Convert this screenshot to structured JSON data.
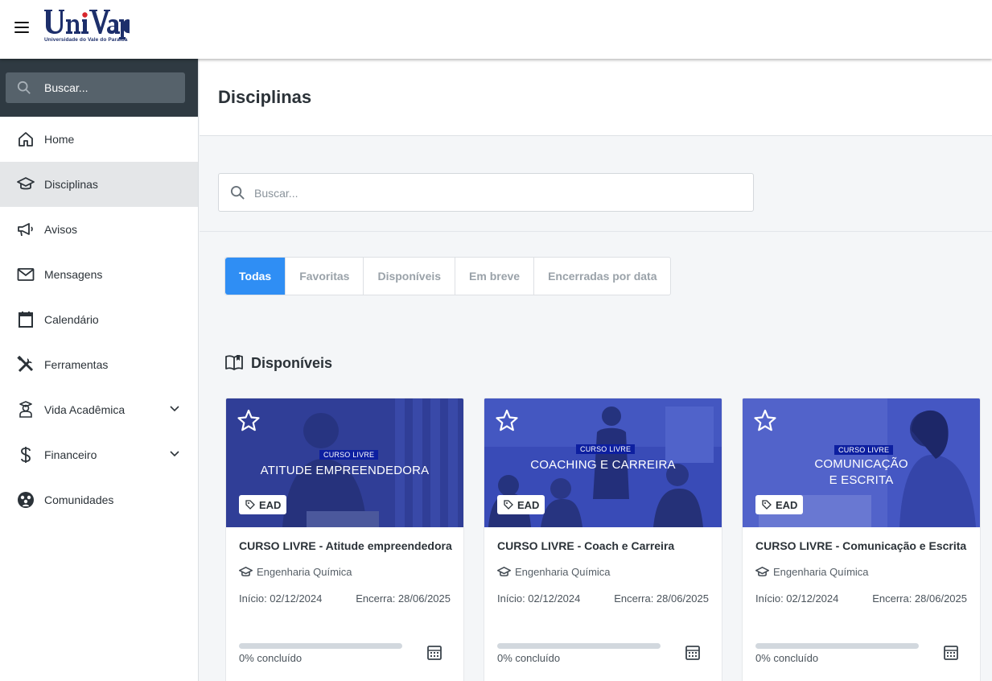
{
  "header": {
    "logo_text": "UniVap",
    "logo_subtitle": "Universidade do Vale do Paraíba"
  },
  "sidebar": {
    "search_label": "Buscar...",
    "items": [
      {
        "label": "Home",
        "icon": "home-icon"
      },
      {
        "label": "Disciplinas",
        "icon": "graduation-cap-icon",
        "active": true
      },
      {
        "label": "Avisos",
        "icon": "megaphone-icon"
      },
      {
        "label": "Mensagens",
        "icon": "envelope-icon"
      },
      {
        "label": "Calendário",
        "icon": "calendar-icon"
      },
      {
        "label": "Ferramentas",
        "icon": "tools-icon"
      },
      {
        "label": "Vida Acadêmica",
        "icon": "student-icon",
        "expandable": true
      },
      {
        "label": "Financeiro",
        "icon": "dollar-icon",
        "expandable": true
      },
      {
        "label": "Comunidades",
        "icon": "community-icon"
      }
    ]
  },
  "main": {
    "title": "Disciplinas",
    "search_placeholder": "Buscar...",
    "tabs": [
      "Todas",
      "Favoritas",
      "Disponíveis",
      "Em breve",
      "Encerradas por data"
    ],
    "active_tab": "Todas",
    "section_title": "Disponíveis",
    "cards": [
      {
        "badge": "CURSO LIVRE",
        "image_title": "ATITUDE EMPREENDEDORA",
        "modality": "EAD",
        "title": "CURSO LIVRE - Atitude empreendedora",
        "course": "Engenharia Química",
        "start": "Início: 02/12/2024",
        "end": "Encerra: 28/06/2025",
        "progress": 0,
        "progress_text": "0% concluído"
      },
      {
        "badge": "CURSO LIVRE",
        "image_title": "COACHING  E CARREIRA",
        "modality": "EAD",
        "title": "CURSO LIVRE - Coach e Carreira",
        "course": "Engenharia Química",
        "start": "Início: 02/12/2024",
        "end": "Encerra: 28/06/2025",
        "progress": 0,
        "progress_text": "0% concluído"
      },
      {
        "badge": "CURSO LIVRE",
        "image_title_line1": "COMUNICAÇÃO",
        "image_title_line2": "E ESCRITA",
        "modality": "EAD",
        "title": "CURSO LIVRE - Comunicação e Escrita",
        "course": "Engenharia Química",
        "start": "Início: 02/12/2024",
        "end": "Encerra: 28/06/2025",
        "progress": 0,
        "progress_text": "0% concluído"
      }
    ]
  },
  "colors": {
    "accent": "#2f8ef4",
    "sidebar_search_bg": "#2f3a42",
    "card_overlay": "#3949b5",
    "badge": "#0d1fa0"
  }
}
